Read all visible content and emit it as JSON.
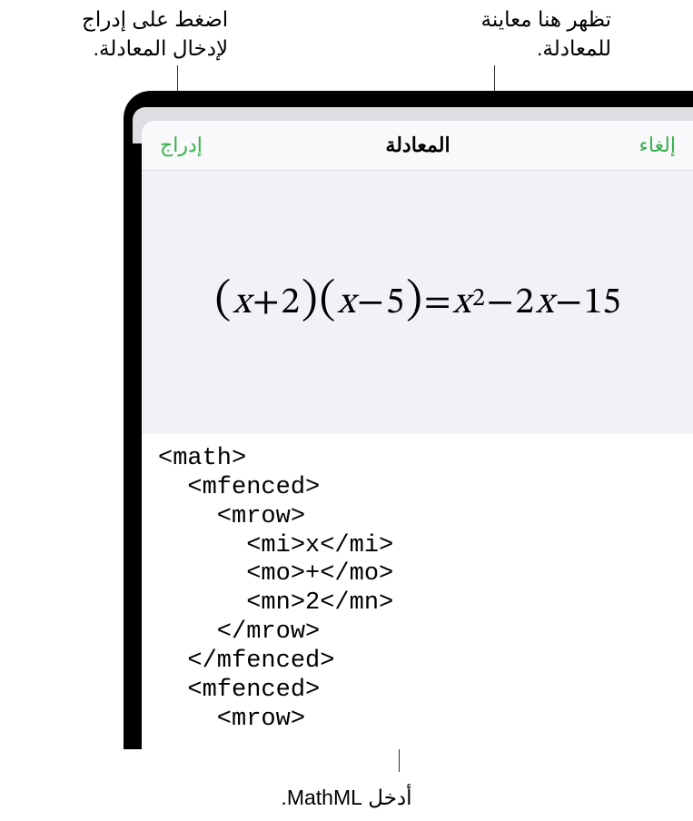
{
  "callouts": {
    "top_left_line1": "اضغط على إدراج",
    "top_left_line2": "لإدخال المعادلة.",
    "top_right_line1": "تظهر هنا معاينة",
    "top_right_line2": "للمعادلة.",
    "bottom": "أدخل MathML."
  },
  "modal": {
    "title": "المعادلة",
    "cancel": "إلغاء",
    "insert": "إدراج"
  },
  "equation": {
    "part1_open": "(",
    "part1_x": "x",
    "part1_op": " + ",
    "part1_n": "2",
    "part1_close": ")",
    "part2_open": "(",
    "part2_x": "x",
    "part2_op": " − ",
    "part2_n": "5",
    "part2_close": ")",
    "eq": " = ",
    "rhs_x": "x",
    "rhs_sup": "2",
    "rhs_m1": " − ",
    "rhs_2": "2",
    "rhs_x2": "x",
    "rhs_m2": " − ",
    "rhs_15": "15"
  },
  "code": "<math>\n  <mfenced>\n    <mrow>\n      <mi>x</mi>\n      <mo>+</mo>\n      <mn>2</mn>\n    </mrow>\n  </mfenced>\n  <mfenced>\n    <mrow>",
  "colors": {
    "accent": "#34b24a",
    "preview_bg": "#f2f1f8",
    "header_bg": "#f9f8fb"
  }
}
